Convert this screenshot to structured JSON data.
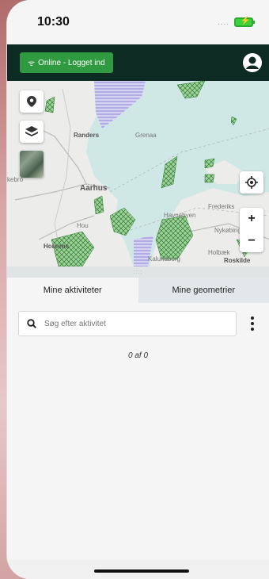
{
  "status_bar": {
    "time": "10:30",
    "signal_dots": "....",
    "battery_icon": "battery-charging-icon"
  },
  "app_bar": {
    "online_label": "Online - Logget ind",
    "online_icon": "wifi-icon",
    "user_icon": "user-icon"
  },
  "map": {
    "labels": [
      "Randers",
      "Grenaa",
      "Aarhus",
      "Havnebyen",
      "Frederiks",
      "Nykøbing",
      "Horsens",
      "Hou",
      "Kalundborg",
      "Holbæk",
      "Roskilde",
      "kebro"
    ],
    "buttons": {
      "location_pin": "map-pin-icon",
      "layers": "layers-icon",
      "locate": "crosshair-icon",
      "zoom_in": "+",
      "zoom_out": "−"
    }
  },
  "tabs": [
    {
      "label": "Mine aktiviteter",
      "active": true
    },
    {
      "label": "Mine geometrier",
      "active": false
    }
  ],
  "search": {
    "placeholder": "Søg efter aktivitet",
    "icon": "search-icon",
    "menu_icon": "more-vertical-icon"
  },
  "count_text": "0 af 0",
  "colors": {
    "app_bar": "#0d2b22",
    "online": "#2f9a3f",
    "hatch_green": "#5aa05a",
    "hatch_purple": "#8c86d6"
  }
}
